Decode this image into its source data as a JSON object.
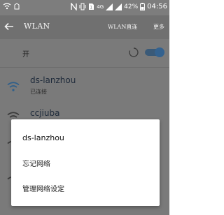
{
  "status_bar": {
    "network_type": "4G",
    "battery_percent": "42%",
    "time": "04:56"
  },
  "header": {
    "title": "WLAN",
    "direct_label": "WLAN直连",
    "more_label": "更多"
  },
  "wlan_toggle": {
    "label": "开",
    "enabled": true
  },
  "networks": [
    {
      "name": "ds-lanzhou",
      "status": "已连接"
    },
    {
      "name": "ccjiuba",
      "status": ""
    }
  ],
  "dialog": {
    "title": "ds-lanzhou",
    "items": [
      "忘记网络",
      "管理网络设定"
    ]
  },
  "colors": {
    "accent": "#34628f",
    "scrim_bg": "#7a7a7a",
    "app_bar": "#707070"
  }
}
